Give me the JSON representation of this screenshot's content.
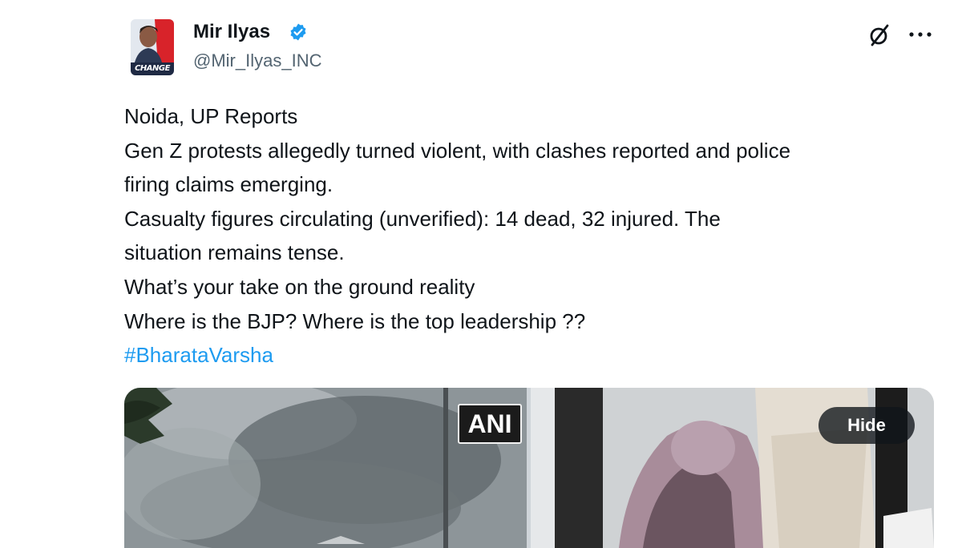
{
  "author": {
    "name": "Mir Ilyas",
    "handle": "@Mir_Ilyas_INC",
    "avatar_tag": "CHANGE",
    "verified": true
  },
  "header_icons": [
    "grok-icon",
    "more-icon"
  ],
  "tweet": {
    "lines": [
      "Noida, UP Reports",
      "Gen Z protests allegedly turned violent, with clashes reported and police",
      "firing claims emerging.",
      "Casualty figures circulating (unverified): 14 dead, 32 injured. The",
      "situation remains tense.",
      "What’s your take on the ground reality",
      "Where is the BJP? Where is the top leadership ??"
    ],
    "hashtag": "#BharataVarsha"
  },
  "media": {
    "left_watermark": "ANI",
    "hide_label": "Hide"
  },
  "colors": {
    "text": "#0f1419",
    "secondary": "#536471",
    "link": "#1d9bf0",
    "verified": "#1d9bf0"
  }
}
